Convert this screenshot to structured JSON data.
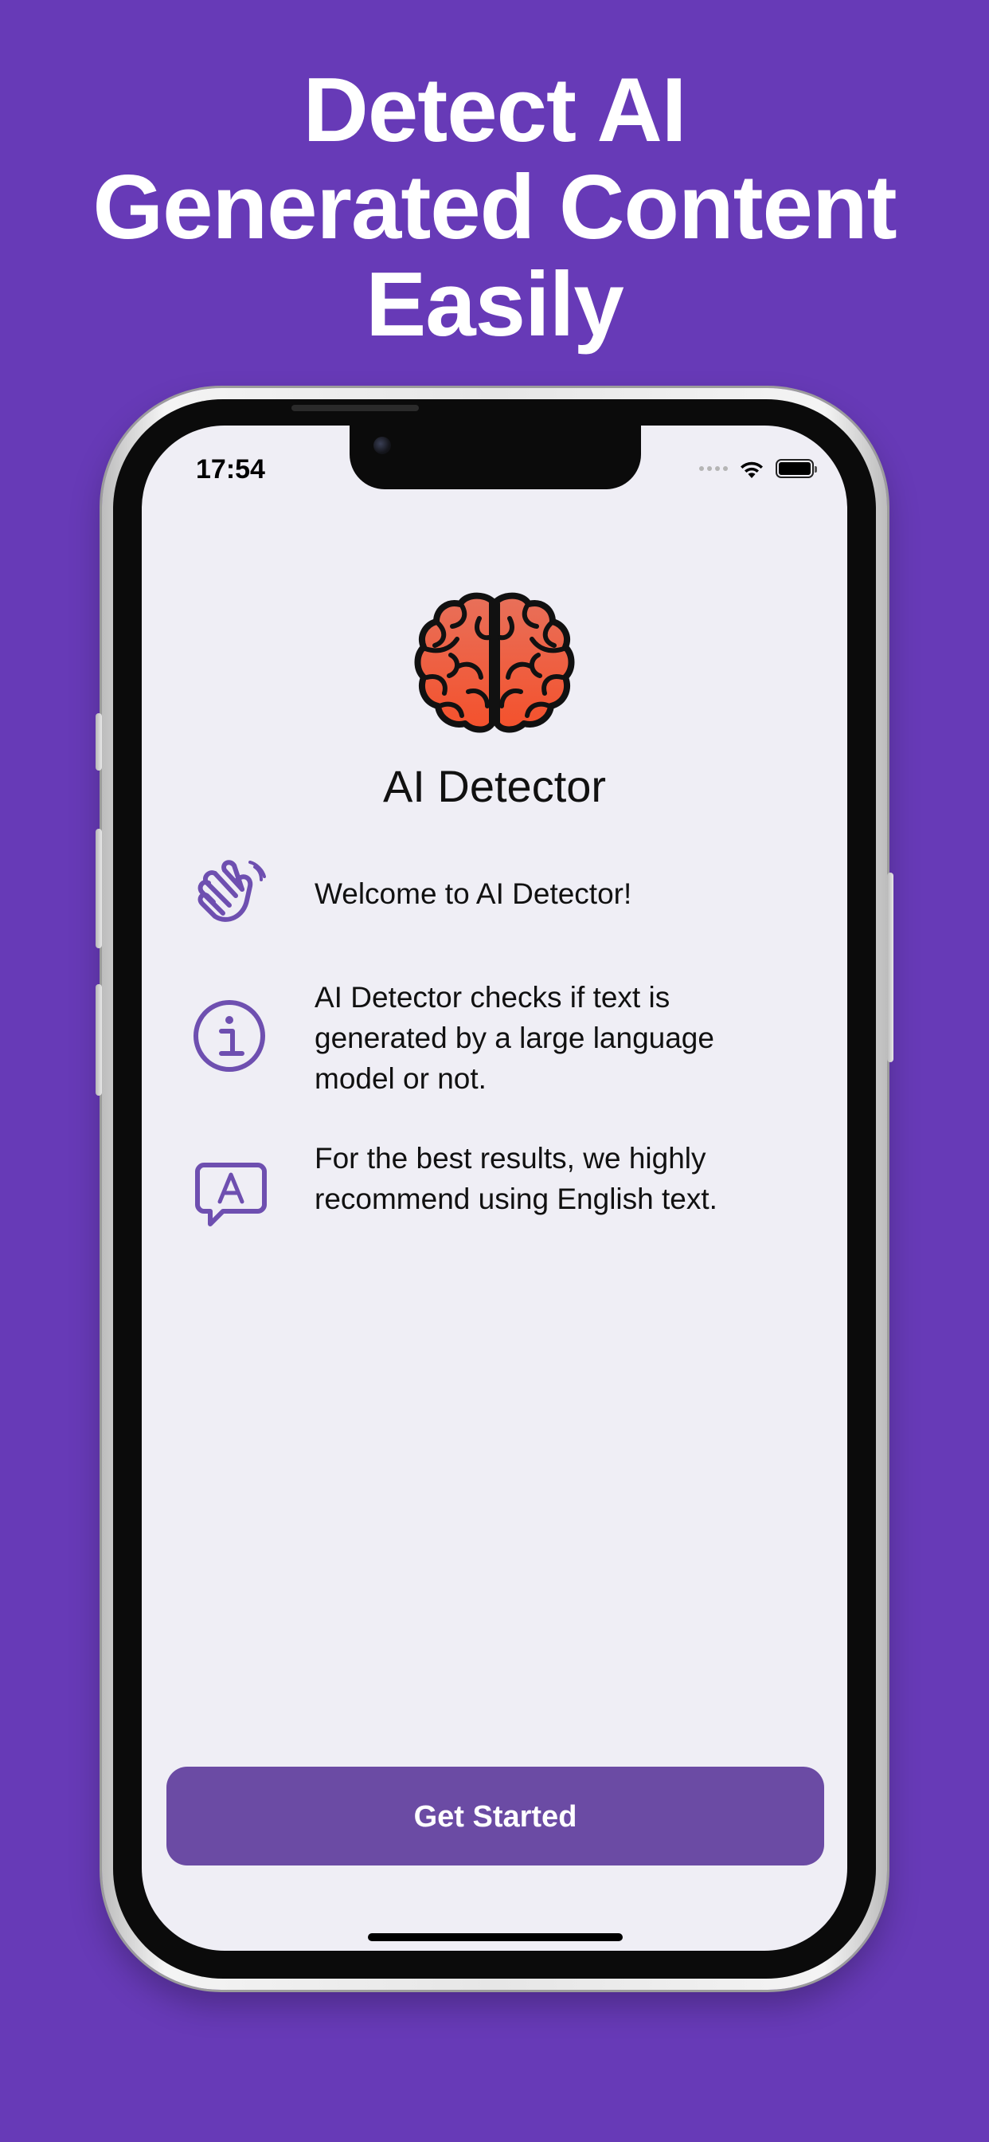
{
  "headline": {
    "line1": "Detect AI",
    "line2": "Generated Content",
    "line3": "Easily"
  },
  "status_bar": {
    "time": "17:54"
  },
  "app": {
    "name": "AI Detector",
    "logo_icon": "brain-icon"
  },
  "features": [
    {
      "icon": "waving-hand-icon",
      "text": "Welcome to AI Detector!"
    },
    {
      "icon": "info-circle-icon",
      "text": "AI Detector checks if text is generated by a large language model or not."
    },
    {
      "icon": "language-bubble-icon",
      "text": "For the best results, we highly recommend using English text."
    }
  ],
  "cta": {
    "label": "Get Started"
  },
  "colors": {
    "background": "#673AB7",
    "screen": "#EFEEF5",
    "accent": "#6B4BA4",
    "icon": "#6E4FB0",
    "brain": "#F06A4F"
  }
}
